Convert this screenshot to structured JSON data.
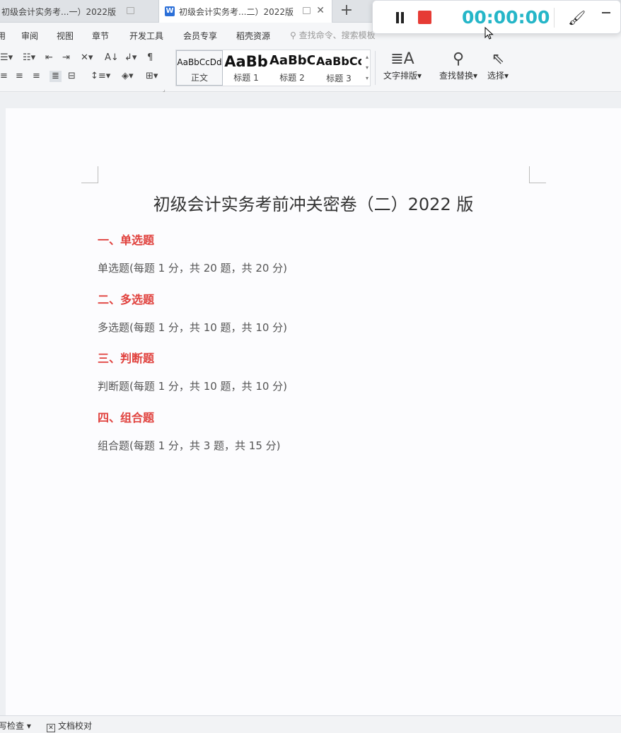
{
  "tabs": [
    {
      "title": "初级会计实务考...一）2022版"
    },
    {
      "title": "初级会计实务考...二）2022版",
      "icon": "W"
    }
  ],
  "new_tab": "+",
  "recorder": {
    "timer": "00:00:00",
    "colors": {
      "timer": "#25b6c8",
      "stop": "#e63b35"
    }
  },
  "menu": {
    "items": [
      "用",
      "审阅",
      "视图",
      "章节",
      "开发工具",
      "会员专享",
      "稻壳资源"
    ],
    "search_placeholder": "查找命令、搜索模板"
  },
  "toolbar": {
    "styles": [
      {
        "sample": "AaBbCcDd",
        "label": "正文"
      },
      {
        "sample": "AaBb",
        "label": "标题 1"
      },
      {
        "sample": "AaBbC",
        "label": "标题 2"
      },
      {
        "sample": "AaBbCc",
        "label": "标题 3"
      }
    ],
    "text_layout": "文字排版",
    "find_replace": "查找替换",
    "select": "选择"
  },
  "document": {
    "title": "初级会计实务考前冲关密卷（二）2022 版",
    "sections": [
      {
        "heading": "一、单选题",
        "desc": "单选题(每题 1 分，共 20 题，共 20 分)"
      },
      {
        "heading": "二、多选题",
        "desc": "多选题(每题 1 分，共 10 题，共 10 分)"
      },
      {
        "heading": "三、判断题",
        "desc": "判断题(每题 1 分，共 10 题，共 10 分)"
      },
      {
        "heading": "四、组合题",
        "desc": "组合题(每题 1 分，共 3 题，共 15 分)"
      }
    ],
    "heading_color": "#e0413d"
  },
  "statusbar": {
    "spell_check": "拼写检查",
    "doc_proof": "文档校对"
  }
}
